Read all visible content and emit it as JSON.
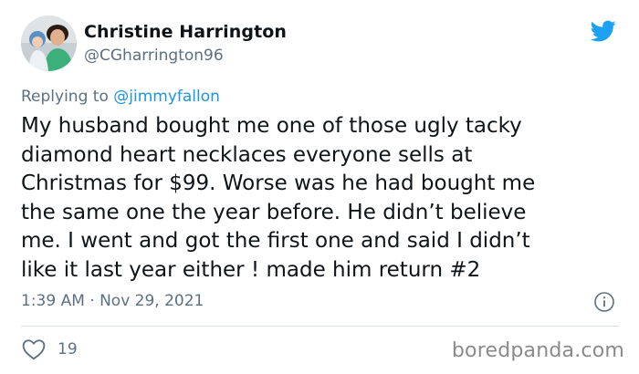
{
  "author": {
    "name": "Christine Harrington",
    "handle": "@CGharrington96"
  },
  "reply": {
    "prefix": "Replying to ",
    "user": "@jimmyfallon"
  },
  "tweet": {
    "lines": [
      "My husband bought me one of those ugly tacky",
      "diamond heart necklaces everyone sells at",
      "Christmas for $99. Worse was he had bought me",
      "the same one the year before. He didn’t believe",
      "me. I went and got the first one and said I didn’t",
      "like it last year either ! made him return #2"
    ]
  },
  "meta": {
    "timestamp": "1:39 AM · Nov 29, 2021"
  },
  "engagement": {
    "likes": "19"
  },
  "watermark": "boredpanda.com",
  "colors": {
    "twitter_blue": "#1da1f2",
    "link_blue": "#1b95e0",
    "secondary_text": "#5b7083"
  },
  "icons": {
    "logo": "twitter-bird-icon",
    "info": "info-circle-icon",
    "like": "heart-outline-icon"
  }
}
